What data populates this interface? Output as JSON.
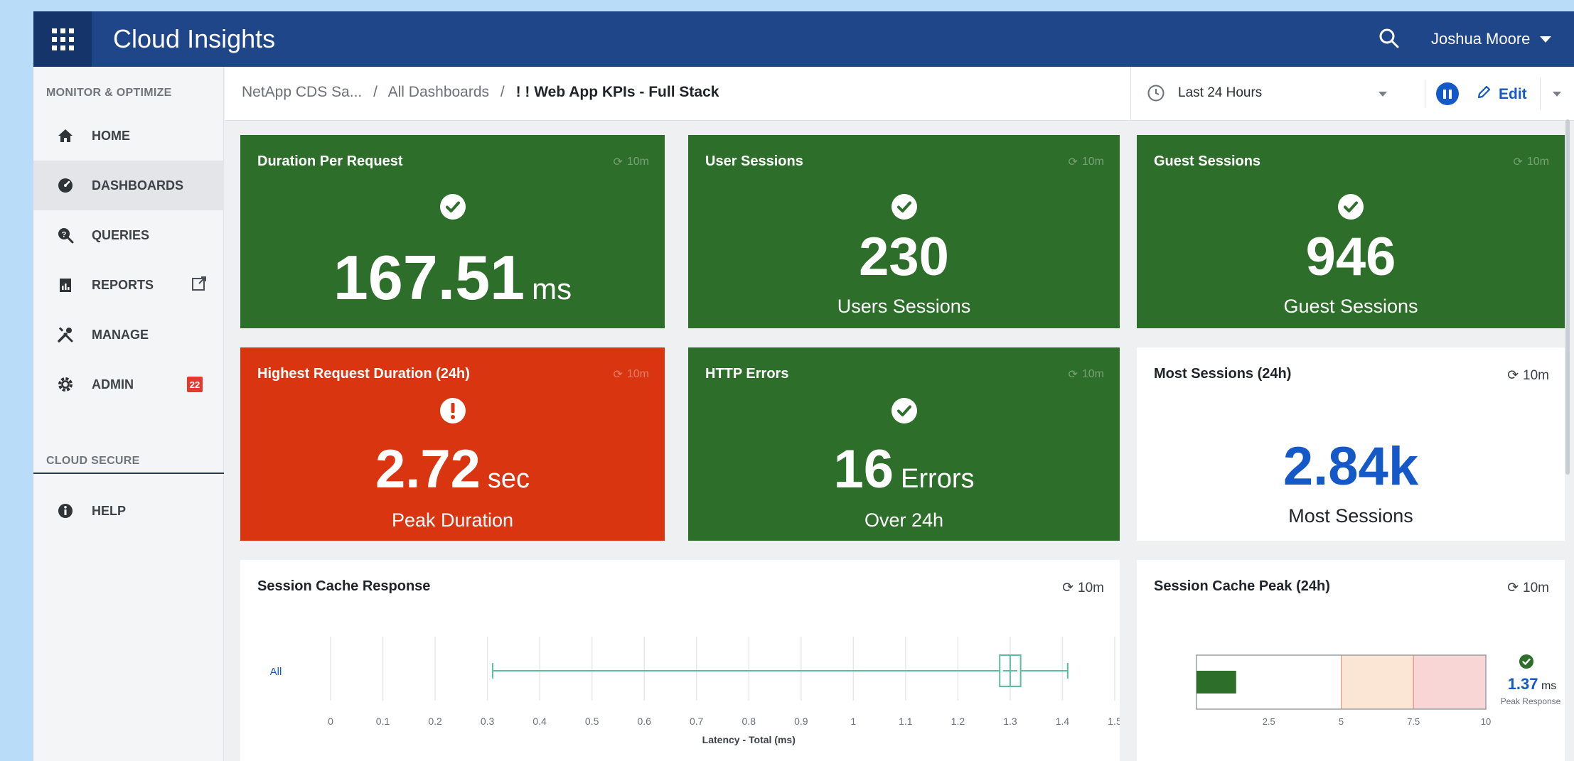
{
  "header": {
    "app_title": "Cloud Insights",
    "user_name": "Joshua Moore"
  },
  "sidebar": {
    "section_monitor": "MONITOR & OPTIMIZE",
    "items": [
      {
        "label": "HOME",
        "icon": "home-icon"
      },
      {
        "label": "DASHBOARDS",
        "icon": "dashboard-gauge-icon"
      },
      {
        "label": "QUERIES",
        "icon": "query-icon"
      },
      {
        "label": "REPORTS",
        "icon": "reports-icon"
      },
      {
        "label": "MANAGE",
        "icon": "tools-icon"
      },
      {
        "label": "ADMIN",
        "icon": "admin-gear-icon",
        "badge": "22"
      }
    ],
    "section_secure": "CLOUD SECURE",
    "help_label": "HELP"
  },
  "breadcrumb": {
    "root": "NetApp CDS Sa...",
    "sep": "/",
    "parent": "All Dashboards",
    "current": "! ! Web App KPIs - Full Stack"
  },
  "toolbar": {
    "time_range": "Last 24 Hours",
    "edit_label": "Edit"
  },
  "widgets": {
    "duration": {
      "title": "Duration Per Request",
      "refresh": "10m",
      "value": "167.51",
      "unit": "ms",
      "status": "ok"
    },
    "user_sessions": {
      "title": "User Sessions",
      "refresh": "10m",
      "value": "230",
      "subtitle": "Users Sessions",
      "status": "ok"
    },
    "guest_sessions": {
      "title": "Guest Sessions",
      "refresh": "10m",
      "value": "946",
      "subtitle": "Guest Sessions",
      "status": "ok"
    },
    "highest_duration": {
      "title": "Highest Request Duration (24h)",
      "refresh": "10m",
      "value": "2.72",
      "unit": "sec",
      "subtitle": "Peak Duration",
      "status": "warning"
    },
    "http_errors": {
      "title": "HTTP Errors",
      "refresh": "10m",
      "value": "16",
      "unit": "Errors",
      "subtitle": "Over 24h",
      "status": "ok"
    },
    "most_sessions": {
      "title": "Most Sessions (24h)",
      "refresh": "10m",
      "value": "2.84k",
      "subtitle": "Most Sessions"
    },
    "session_cache_response": {
      "title": "Session Cache Response",
      "refresh": "10m"
    },
    "session_cache_peak": {
      "title": "Session Cache Peak (24h)",
      "refresh": "10m",
      "value": "1.37",
      "unit": "ms",
      "caption": "Peak Response"
    }
  },
  "colors": {
    "green": "#2d6e2a",
    "red": "#d93511",
    "blue": "#1559c9",
    "topbar": "#1f4688",
    "boxplot": "#5bbf9f"
  },
  "chart_data": [
    {
      "type": "boxplot",
      "title": "Session Cache Response",
      "xlabel": "Latency - Total (ms)",
      "category": "All",
      "xlim": [
        0,
        1.5
      ],
      "ticks": [
        "0",
        "0.1",
        "0.2",
        "0.3",
        "0.4",
        "0.5",
        "0.6",
        "0.7",
        "0.8",
        "0.9",
        "1",
        "1.1",
        "1.2",
        "1.3",
        "1.4",
        "1.5"
      ],
      "min": 0.31,
      "q1": 1.28,
      "median": 1.3,
      "q3": 1.32,
      "max": 1.41,
      "grid": true
    },
    {
      "type": "bullet",
      "title": "Session Cache Peak (24h)",
      "value": 1.37,
      "xlim": [
        0,
        10
      ],
      "ticks": [
        "2.5",
        "5",
        "7.5",
        "10"
      ],
      "bands": [
        {
          "from": 0,
          "to": 5,
          "color": "#ffffff"
        },
        {
          "from": 5,
          "to": 7.5,
          "color": "#fbe5d4"
        },
        {
          "from": 7.5,
          "to": 10,
          "color": "#f8d6d6"
        }
      ]
    }
  ]
}
